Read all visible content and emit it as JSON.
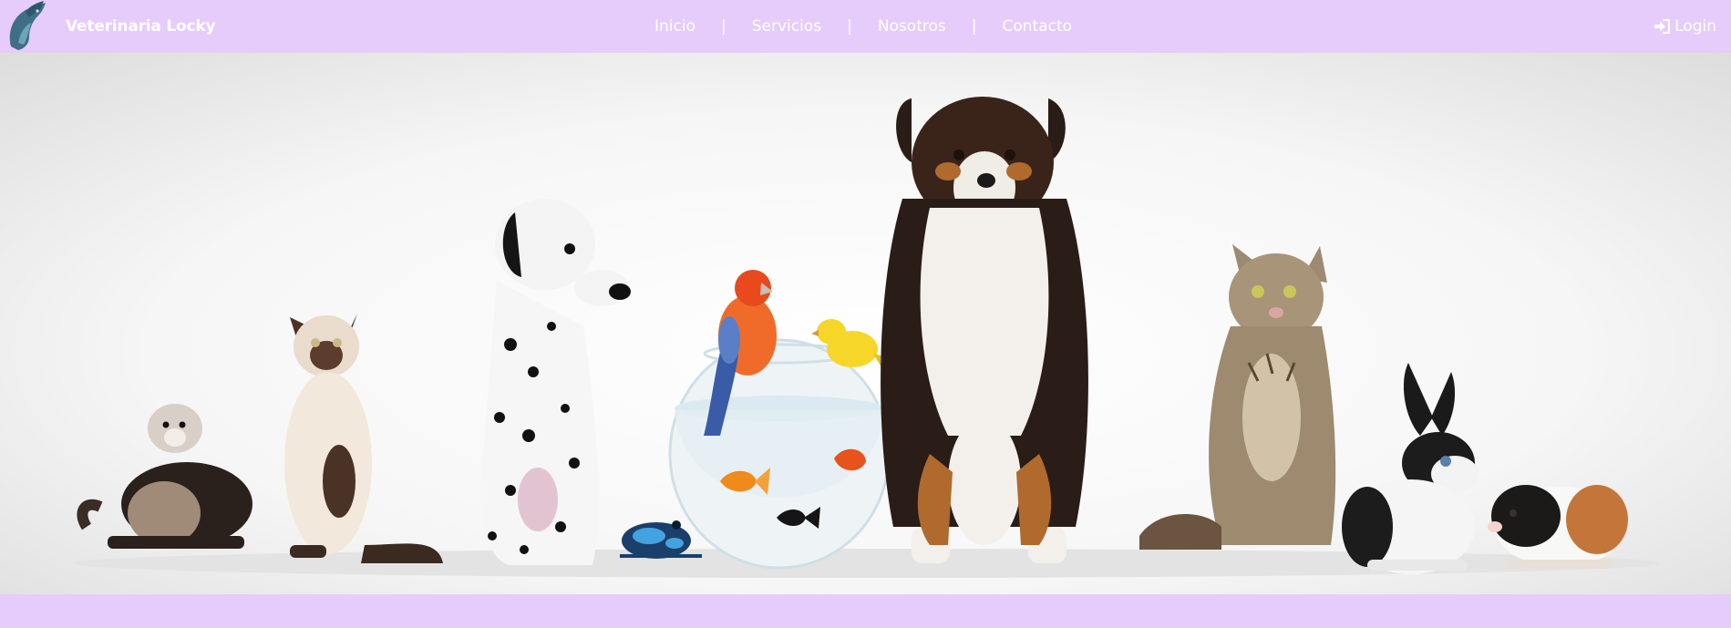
{
  "brand": {
    "name": "Veterinaria Locky",
    "logo_icon": "horse-cat-dog-logo-icon"
  },
  "nav": {
    "items": [
      {
        "label": "Inicio"
      },
      {
        "label": "Servicios"
      },
      {
        "label": "Nosotros"
      },
      {
        "label": "Contacto"
      }
    ],
    "separator": "|"
  },
  "login": {
    "label": "Login",
    "icon": "sign-in-icon"
  },
  "hero": {
    "image": "pets-group-hero-image"
  },
  "colors": {
    "navbar_bg": "#e6ccfb",
    "text": "#ffffff"
  }
}
